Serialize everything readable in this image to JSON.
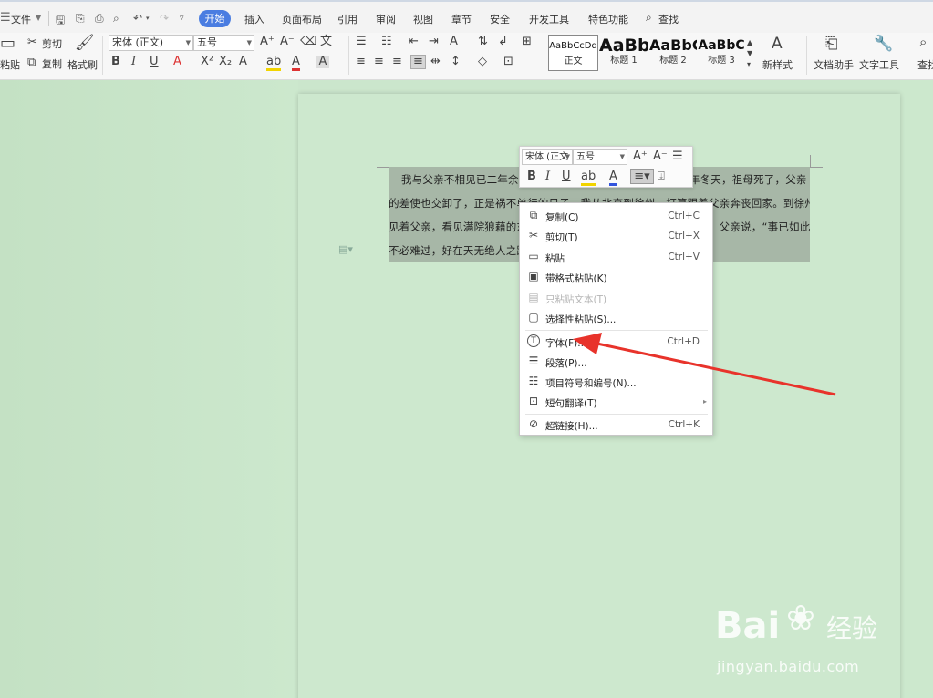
{
  "menubar": {
    "file": "文件",
    "tabs": [
      "开始",
      "插入",
      "页面布局",
      "引用",
      "审阅",
      "视图",
      "章节",
      "安全",
      "开发工具",
      "特色功能"
    ],
    "search": "查找"
  },
  "ribbon": {
    "paste": "粘贴",
    "cut": "剪切",
    "copy": "复制",
    "format_painter": "格式刷",
    "font_name": "宋体 (正文)",
    "font_size": "五号",
    "styles": [
      {
        "preview": "AaBbCcDd",
        "name": "正文"
      },
      {
        "preview": "AaBb",
        "name": "标题 1"
      },
      {
        "preview": "AaBbC",
        "name": "标题 2"
      },
      {
        "preview": "AaBbC",
        "name": "标题 3"
      }
    ],
    "new_style": "新样式",
    "doc_helper": "文档助手",
    "text_tools": "文字工具",
    "find_replace": "查找"
  },
  "document": {
    "lines": [
      "我与父亲不相见已二年余了，我最不能忘记的是他的背影。那年冬天，祖母死了，父亲",
      "的差使也交卸了，正是祸不单行的日子。我从北京到徐州，打算跟着父亲奔丧回家。到徐州",
      "见着父亲，看见满院狼藉的东西，又想起祖母，不禁簌簌地流下眼泪。父亲说，“事已如此，",
      "不必难过，好在天无绝人之路！”"
    ]
  },
  "mini_toolbar": {
    "font_name": "宋体 (正文",
    "font_size": "五号"
  },
  "context_menu": {
    "items": [
      {
        "label": "复制(C)",
        "shortcut": "Ctrl+C",
        "icon": "copy-icon"
      },
      {
        "label": "剪切(T)",
        "shortcut": "Ctrl+X",
        "icon": "scissors-icon"
      },
      {
        "label": "粘贴",
        "shortcut": "Ctrl+V",
        "icon": "paste-icon"
      },
      {
        "label": "带格式粘贴(K)",
        "shortcut": "",
        "icon": "paste-format-icon"
      },
      {
        "label": "只粘贴文本(T)",
        "shortcut": "",
        "icon": "paste-text-icon"
      },
      {
        "label": "选择性粘贴(S)...",
        "shortcut": "",
        "icon": "paste-special-icon"
      },
      {
        "label": "字体(F)...",
        "shortcut": "Ctrl+D",
        "icon": "font-icon"
      },
      {
        "label": "段落(P)...",
        "shortcut": "",
        "icon": "paragraph-icon"
      },
      {
        "label": "项目符号和编号(N)...",
        "shortcut": "",
        "icon": "bullets-icon"
      },
      {
        "label": "短句翻译(T)",
        "shortcut": "",
        "icon": "translate-icon"
      },
      {
        "label": "超链接(H)...",
        "shortcut": "Ctrl+K",
        "icon": "link-icon"
      }
    ]
  },
  "watermark": {
    "brand": "Bai",
    "brand_suffix": "经验",
    "url": "jingyan.baidu.com"
  },
  "colors": {
    "accent": "#4a7de1",
    "page_bg": "#cde8ce",
    "selection": "#a7b7a7",
    "arrow": "#e8332b"
  }
}
